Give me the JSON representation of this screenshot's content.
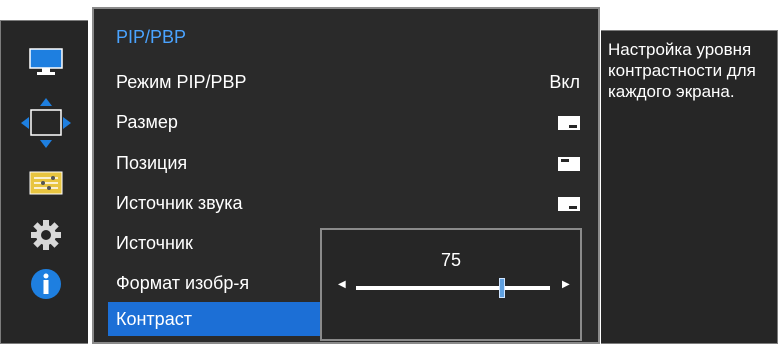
{
  "sidebar": {
    "icons": [
      {
        "name": "monitor-icon"
      },
      {
        "name": "pip-pbp-arrows-icon",
        "active": true
      },
      {
        "name": "settings-list-icon"
      },
      {
        "name": "gear-icon"
      },
      {
        "name": "info-icon"
      }
    ],
    "accent_color": "#1e7fe0"
  },
  "menu": {
    "title": "PIP/PBP",
    "items": [
      {
        "label": "Режим PIP/PBP",
        "value": "Вкл"
      },
      {
        "label": "Размер",
        "icon": "size-icon"
      },
      {
        "label": "Позиция",
        "icon": "position-icon"
      },
      {
        "label": "Источник звука",
        "icon": "sound-source-icon"
      },
      {
        "label": "Источник"
      },
      {
        "label": "Формат изобр-я"
      },
      {
        "label": "Контраст",
        "selected": true
      }
    ]
  },
  "slider": {
    "value": "75",
    "value_fraction": 0.75
  },
  "help": {
    "text": "Настройка уровня контрастности для каждого экрана."
  },
  "colors": {
    "panel_bg": "#2a2a2a",
    "title": "#4aa3ff",
    "selected": "#1c6fd6",
    "border": "#8a8a8a"
  }
}
